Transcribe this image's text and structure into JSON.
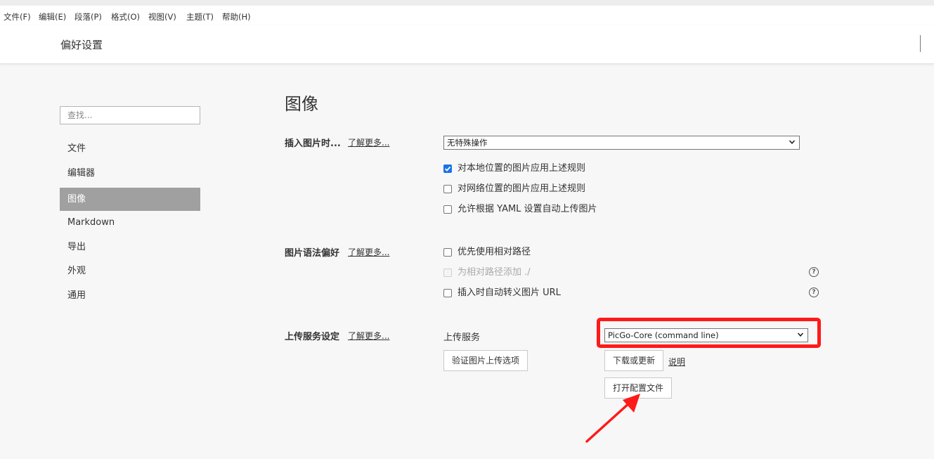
{
  "menu": [
    "文件(F)",
    "编辑(E)",
    "段落(P)",
    "格式(O)",
    "视图(V)",
    "主题(T)",
    "帮助(H)"
  ],
  "window_title": "偏好设置",
  "sidebar": {
    "search_placeholder": "查找...",
    "items": [
      "文件",
      "编辑器",
      "图像",
      "Markdown",
      "导出",
      "外观",
      "通用"
    ],
    "active_index": 2
  },
  "main": {
    "heading": "图像",
    "learn_more": "了解更多...",
    "insert": {
      "label": "插入图片时...",
      "select_value": "无特殊操作",
      "options": [
        {
          "text": "对本地位置的图片应用上述规则",
          "checked": true
        },
        {
          "text": "对网络位置的图片应用上述规则",
          "checked": false
        },
        {
          "text": "允许根据 YAML 设置自动上传图片",
          "checked": false
        }
      ]
    },
    "syntax": {
      "label": "图片语法偏好",
      "options": [
        {
          "text": "优先使用相对路径",
          "checked": false,
          "disabled": false
        },
        {
          "text": "为相对路径添加 ./",
          "checked": false,
          "disabled": true
        },
        {
          "text": "插入时自动转义图片 URL",
          "checked": false,
          "disabled": false
        }
      ],
      "help_glyph": "?"
    },
    "upload": {
      "label": "上传服务设定",
      "service_label": "上传服务",
      "service_value": "PicGo-Core (command line)",
      "verify_button": "验证图片上传选项",
      "download_button": "下载或更新",
      "explain_link": "说明",
      "open_config_button": "打开配置文件"
    }
  },
  "annotation": {
    "color": "#ff1a1a"
  }
}
